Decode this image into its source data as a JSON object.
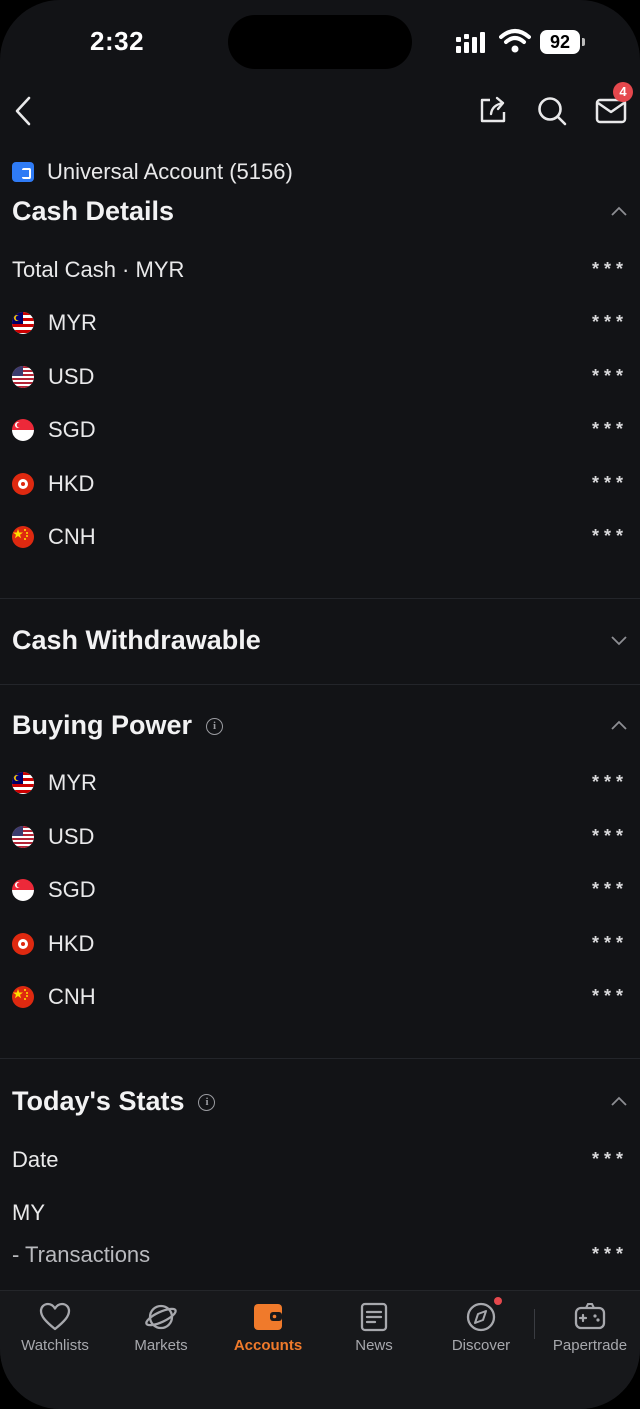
{
  "status": {
    "time": "2:32",
    "battery": "92"
  },
  "topbar": {
    "mail_badge": "4"
  },
  "account": {
    "label": "Universal Account (5156)"
  },
  "cash_details": {
    "title": "Cash Details",
    "total_label": "Total Cash · MYR",
    "masked": "***",
    "rows": [
      {
        "currency": "MYR",
        "value": "***"
      },
      {
        "currency": "USD",
        "value": "***"
      },
      {
        "currency": "SGD",
        "value": "***"
      },
      {
        "currency": "HKD",
        "value": "***"
      },
      {
        "currency": "CNH",
        "value": "***"
      }
    ]
  },
  "cash_withdrawable": {
    "title": "Cash Withdrawable"
  },
  "buying_power": {
    "title": "Buying Power",
    "info_icon": "info-icon",
    "rows": [
      {
        "currency": "MYR",
        "value": "***"
      },
      {
        "currency": "USD",
        "value": "***"
      },
      {
        "currency": "SGD",
        "value": "***"
      },
      {
        "currency": "HKD",
        "value": "***"
      },
      {
        "currency": "CNH",
        "value": "***"
      }
    ]
  },
  "todays_stats": {
    "title": "Today's Stats",
    "date_label": "Date",
    "date_value": "***",
    "region": "MY",
    "transactions_label": "- Transactions",
    "transactions_value": "***"
  },
  "tabs": [
    {
      "label": "Watchlists",
      "icon": "heart-icon"
    },
    {
      "label": "Markets",
      "icon": "planet-icon"
    },
    {
      "label": "Accounts",
      "icon": "wallet-icon",
      "active": true
    },
    {
      "label": "News",
      "icon": "news-icon"
    },
    {
      "label": "Discover",
      "icon": "compass-icon"
    },
    {
      "label": "Papertrade",
      "icon": "gamepad-icon"
    }
  ],
  "colors": {
    "accent": "#f07a2b",
    "background": "#121316",
    "badge": "#e5484d",
    "account_icon": "#2f7bf5"
  }
}
